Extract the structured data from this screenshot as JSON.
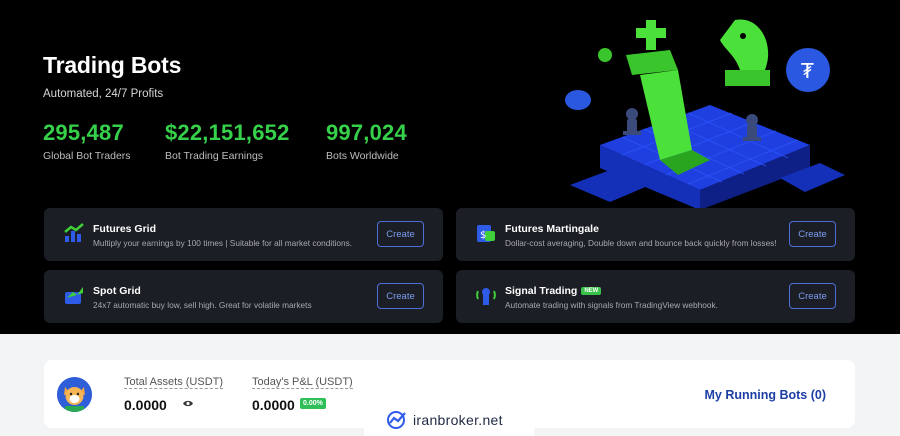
{
  "hero": {
    "title": "Trading Bots",
    "subtitle": "Automated, 24/7 Profits",
    "stats": [
      {
        "value": "295,487",
        "label": "Global Bot Traders"
      },
      {
        "value": "$22,151,652",
        "label": "Bot Trading Earnings"
      },
      {
        "value": "997,024",
        "label": "Bots Worldwide"
      }
    ]
  },
  "bots": [
    {
      "icon": "futures-grid-icon",
      "title": "Futures Grid",
      "desc": "Multiply your earnings by 100 times | Suitable for all market conditions.",
      "button": "Create"
    },
    {
      "icon": "futures-martingale-icon",
      "title": "Futures Martingale",
      "desc": "Dollar-cost averaging, Double down and bounce back quickly from losses!",
      "button": "Create"
    },
    {
      "icon": "spot-grid-icon",
      "title": "Spot Grid",
      "desc": "24x7 automatic buy low, sell high. Great for volatile markets",
      "button": "Create"
    },
    {
      "icon": "signal-trading-icon",
      "title": "Signal Trading",
      "badge": "NEW",
      "desc": "Automate trading with signals from TradingView webhook.",
      "button": "Create"
    }
  ],
  "account": {
    "total_assets_label": "Total Assets (USDT)",
    "total_assets_value": "0.0000",
    "pnl_label": "Today's P&L (USDT)",
    "pnl_value": "0.0000",
    "pnl_pct": "0.00%",
    "running_bots": "My Running Bots (0)"
  },
  "watermark": "iranbroker.net",
  "colors": {
    "accent_green": "#36d14a",
    "button_blue": "#4d6fd8",
    "brand_blue": "#1d3fa5"
  }
}
